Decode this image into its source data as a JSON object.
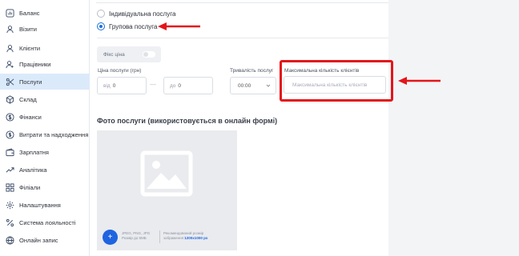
{
  "sidebar": {
    "items": [
      {
        "label": "Баланс",
        "icon": "chart-square-icon",
        "active": false
      },
      {
        "label": "Візити",
        "icon": "user-icon",
        "active": false
      },
      {
        "label": "Клієнти",
        "icon": "user-icon",
        "active": false
      },
      {
        "label": "Працівники",
        "icon": "user-tie-icon",
        "active": false
      },
      {
        "label": "Послуги",
        "icon": "scissors-icon",
        "active": true
      },
      {
        "label": "Склад",
        "icon": "box-icon",
        "active": false
      },
      {
        "label": "Фінанси",
        "icon": "dollar-circle-icon",
        "active": false
      },
      {
        "label": "Витрати та надходження",
        "icon": "money-icon",
        "active": false
      },
      {
        "label": "Зарплатня",
        "icon": "wallet-icon",
        "active": false
      },
      {
        "label": "Аналітика",
        "icon": "trend-icon",
        "active": false
      },
      {
        "label": "Філіали",
        "icon": "grid-icon",
        "active": false
      },
      {
        "label": "Налаштування",
        "icon": "settings-icon",
        "active": false
      },
      {
        "label": "Система лояльності",
        "icon": "percent-icon",
        "active": false
      },
      {
        "label": "Онлайн запис",
        "icon": "globe-icon",
        "active": false
      }
    ]
  },
  "form": {
    "service_type": {
      "options": [
        "Індивідуальна послуга",
        "Групова послуга"
      ],
      "selected": "Групова послуга"
    },
    "fixed_price_label": "Фікс ціна",
    "price_label": "Ціна послуги (грн)",
    "price_from_prefix": "від",
    "price_from_value": "0",
    "price_to_prefix": "до",
    "price_to_value": "0",
    "duration_label": "Тривалість послуг",
    "duration_value": "00:00",
    "max_clients_label": "Максимальна кількість клієнтів",
    "max_clients_placeholder": "Максимальна кількість клієнтів",
    "photo_title": "Фото послуги (використовується в онлайн формі)",
    "upload_button": "+",
    "upload_formats": "JPEG, PNG, JPG",
    "upload_size": "Розмір до 5МБ",
    "recommended_label": "Рекомендований розмір",
    "recommended_prefix": "зображення",
    "recommended_size": "1200x1000 px"
  },
  "colors": {
    "accent": "#1c6fe0",
    "annotation": "#e3151a",
    "active_item_bg": "#dbeafa"
  }
}
